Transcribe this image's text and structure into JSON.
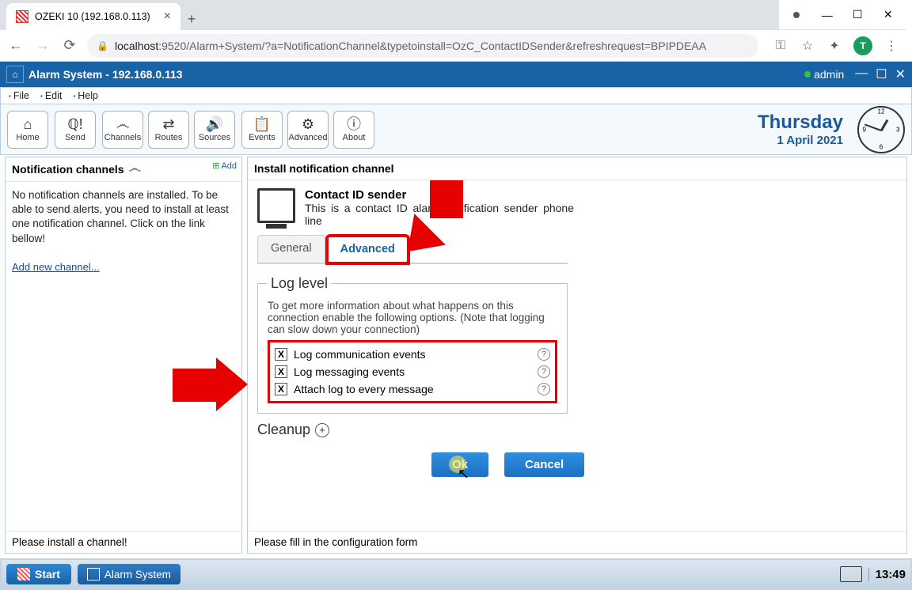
{
  "browser": {
    "tab_title": "OZEKI 10 (192.168.0.113)",
    "url_host": "localhost",
    "url_port_path": ":9520/Alarm+System/?a=NotificationChannel&typetoinstall=OzC_ContactIDSender&refreshrequest=BPIPDEAA",
    "profile_letter": "T"
  },
  "app": {
    "title": "Alarm System - 192.168.0.113",
    "user": "admin"
  },
  "menus": {
    "file": "File",
    "edit": "Edit",
    "help": "Help"
  },
  "toolbar": {
    "home": "Home",
    "send": "Send",
    "channels": "Channels",
    "routes": "Routes",
    "sources": "Sources",
    "events": "Events",
    "advanced": "Advanced",
    "about": "About"
  },
  "date": {
    "weekday": "Thursday",
    "full": "1 April 2021"
  },
  "left": {
    "header": "Notification channels",
    "add": "Add",
    "body": "No notification channels are installed. To be able to send alerts, you need to install at least one notification channel. Click on the link bellow!",
    "link": "Add new channel...",
    "footer": "Please install a channel!"
  },
  "right": {
    "header": "Install notification channel",
    "sender_title": "Contact ID sender",
    "sender_desc": "This is a contact ID alarm notification sender phone line",
    "tabs": {
      "general": "General",
      "advanced": "Advanced"
    },
    "log_legend": "Log level",
    "log_note": "To get more information about what happens on this connection enable the following options. (Note that logging can slow down your connection)",
    "checks": {
      "c1": "Log communication events",
      "c2": "Log messaging events",
      "c3": "Attach log to every message"
    },
    "cleanup": "Cleanup",
    "ok": "Ok",
    "cancel": "Cancel",
    "footer": "Please fill in the configuration form"
  },
  "taskbar": {
    "start": "Start",
    "app": "Alarm System",
    "time": "13:49"
  }
}
